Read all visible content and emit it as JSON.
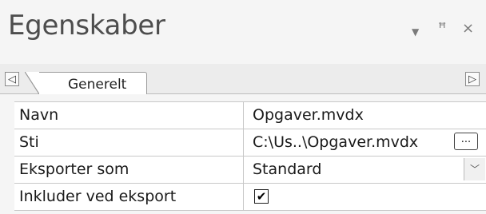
{
  "panel": {
    "title": "Egenskaber",
    "dropdown_icon": "▼",
    "pin_icon": "ꟸ",
    "close_icon": "×"
  },
  "tabstrip": {
    "scroll_left_icon": "◁",
    "scroll_right_icon": "▷",
    "active_tab": "Generelt"
  },
  "properties": [
    {
      "name": "Navn",
      "value": "Opgaver.mvdx"
    },
    {
      "name": "Sti",
      "value": "C:\\Us..\\Opgaver.mvdx",
      "button_label": "..."
    },
    {
      "name": "Eksporter som",
      "value": "Standard",
      "dropdown_icon": "﹀"
    },
    {
      "name": "Inkluder ved eksport",
      "checked": true,
      "check_glyph": "✔"
    }
  ]
}
